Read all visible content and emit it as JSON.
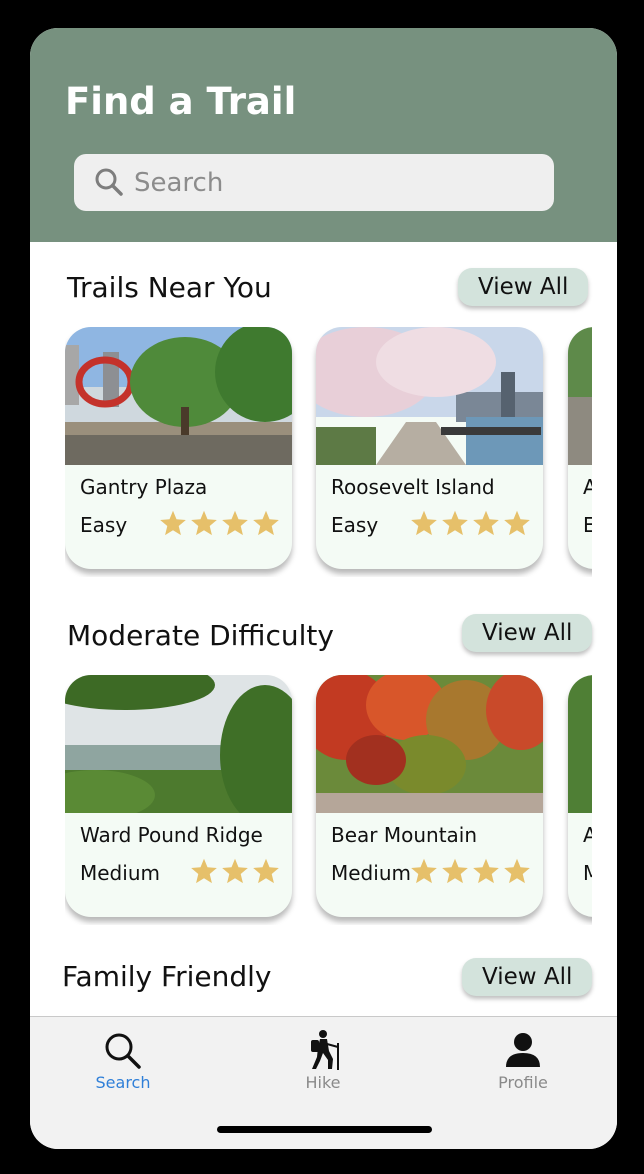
{
  "header": {
    "title": "Find a Trail",
    "search_placeholder": "Search"
  },
  "sections": [
    {
      "title": "Trails Near You",
      "view_all": "View All",
      "cards": [
        {
          "name": "Gantry Plaza",
          "level": "Easy",
          "rating": 4
        },
        {
          "name": "Roosevelt Island",
          "level": "Easy",
          "rating": 4
        },
        {
          "name": "A",
          "level": "E",
          "rating": 0
        }
      ]
    },
    {
      "title": "Moderate Difficulty",
      "view_all": "View All",
      "cards": [
        {
          "name": "Ward Pound Ridge",
          "level": "Medium",
          "rating": 3
        },
        {
          "name": "Bear Mountain",
          "level": "Medium",
          "rating": 4
        },
        {
          "name": "A",
          "level": "M",
          "rating": 0
        }
      ]
    },
    {
      "title": "Family Friendly",
      "view_all": "View All",
      "cards": []
    }
  ],
  "tabbar": {
    "tabs": [
      {
        "label": "Search",
        "icon": "search-icon",
        "active": true
      },
      {
        "label": "Hike",
        "icon": "hiker-icon",
        "active": false
      },
      {
        "label": "Profile",
        "icon": "person-icon",
        "active": false
      }
    ]
  },
  "colors": {
    "header_bg": "#77917f",
    "card_bg": "#f4fbf5",
    "view_all_bg": "#d3e3dc",
    "star": "#e6c06a",
    "active_tab": "#2f7fd8",
    "inactive_tab": "#8a8a8a"
  }
}
